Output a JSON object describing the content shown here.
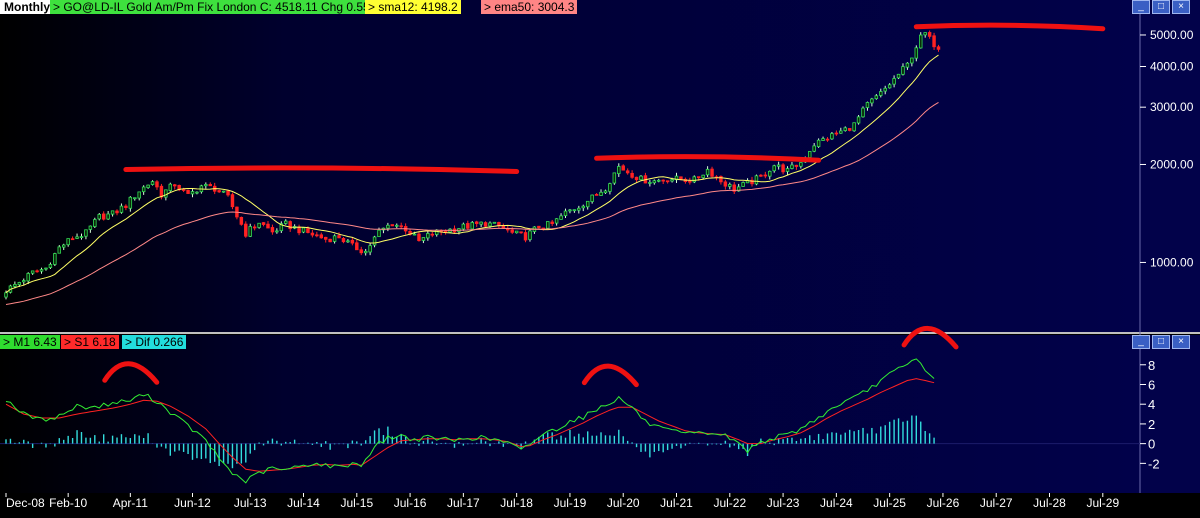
{
  "header": {
    "period": "Monthly",
    "symbol_label": "> GO@LD-IL  Gold Am/Pm Fix  London  C: 4518.11  Chg 0.55",
    "sma_label": "> sma12: 4198.2",
    "ema_label": "> ema50: 3004.3"
  },
  "indicator_header": {
    "m1_label": "> M1  6.43",
    "s1_label": "> S1  6.18",
    "dif_label": "> Dif  0.266"
  },
  "window_buttons": [
    "minimize-icon",
    "restore-icon",
    "close-icon"
  ],
  "colors": {
    "background": "#01014a",
    "up_candle": "#33dd55",
    "down_candle": "#ff2222",
    "sma": "#ffff66",
    "ema": "#ff8888",
    "m1": "#33ee33",
    "s1": "#ff2222",
    "dif": "#33dddd",
    "annotation": "#ee1111"
  },
  "chart_data": [
    {
      "type": "line",
      "title": "Gold Am/Pm Fix London (Monthly)",
      "scale": "log",
      "ylim": [
        620,
        5800
      ],
      "y_ticks": [
        "1000.00",
        "2000.00",
        "3000.00",
        "4000.00",
        "5000.00"
      ],
      "y_tick_values": [
        1000,
        2000,
        3000,
        4000,
        5000
      ],
      "x_ticks": [
        "Dec-08",
        "Feb-10",
        "Apr-11",
        "Jun-12",
        "Jul-13",
        "Jul-14",
        "Jul-15",
        "Jul-16",
        "Jul-17",
        "Jul-18",
        "Jul-19",
        "Jul-20",
        "Jul-21",
        "Jul-22",
        "Jul-23",
        "Jul-24",
        "Jul-25",
        "Jul-26",
        "Jul-27",
        "Jul-28",
        "Jul-29"
      ],
      "x_tick_months": [
        0,
        14,
        28,
        42,
        55,
        67,
        79,
        91,
        103,
        115,
        127,
        139,
        151,
        163,
        175,
        187,
        199,
        211,
        223,
        235,
        247
      ],
      "price_keypoints": [
        [
          0,
          820
        ],
        [
          3,
          870
        ],
        [
          6,
          930
        ],
        [
          9,
          960
        ],
        [
          12,
          1110
        ],
        [
          15,
          1190
        ],
        [
          18,
          1230
        ],
        [
          21,
          1380
        ],
        [
          24,
          1410
        ],
        [
          27,
          1500
        ],
        [
          30,
          1660
        ],
        [
          33,
          1780
        ],
        [
          35,
          1620
        ],
        [
          38,
          1740
        ],
        [
          41,
          1600
        ],
        [
          44,
          1720
        ],
        [
          47,
          1690
        ],
        [
          50,
          1580
        ],
        [
          52,
          1390
        ],
        [
          54,
          1230
        ],
        [
          57,
          1330
        ],
        [
          60,
          1240
        ],
        [
          63,
          1310
        ],
        [
          66,
          1260
        ],
        [
          69,
          1220
        ],
        [
          72,
          1180
        ],
        [
          75,
          1200
        ],
        [
          78,
          1120
        ],
        [
          81,
          1080
        ],
        [
          84,
          1240
        ],
        [
          87,
          1320
        ],
        [
          90,
          1270
        ],
        [
          93,
          1160
        ],
        [
          96,
          1230
        ],
        [
          99,
          1250
        ],
        [
          102,
          1280
        ],
        [
          105,
          1300
        ],
        [
          108,
          1320
        ],
        [
          111,
          1290
        ],
        [
          114,
          1230
        ],
        [
          117,
          1200
        ],
        [
          120,
          1290
        ],
        [
          123,
          1310
        ],
        [
          126,
          1420
        ],
        [
          129,
          1490
        ],
        [
          132,
          1580
        ],
        [
          135,
          1700
        ],
        [
          138,
          1970
        ],
        [
          140,
          1900
        ],
        [
          143,
          1800
        ],
        [
          146,
          1780
        ],
        [
          149,
          1810
        ],
        [
          152,
          1800
        ],
        [
          155,
          1790
        ],
        [
          158,
          1930
        ],
        [
          161,
          1780
        ],
        [
          164,
          1680
        ],
        [
          167,
          1750
        ],
        [
          170,
          1830
        ],
        [
          173,
          1990
        ],
        [
          176,
          1910
        ],
        [
          179,
          2030
        ],
        [
          182,
          2310
        ],
        [
          185,
          2420
        ],
        [
          188,
          2520
        ],
        [
          191,
          2650
        ],
        [
          194,
          3050
        ],
        [
          197,
          3300
        ],
        [
          200,
          3650
        ],
        [
          203,
          4050
        ],
        [
          206,
          4900
        ],
        [
          207,
          5050
        ],
        [
          208,
          4850
        ],
        [
          209,
          4700
        ],
        [
          210,
          4518
        ]
      ],
      "series": [
        {
          "name": "sma12",
          "value_last": 4198.2
        },
        {
          "name": "ema50",
          "value_last": 3004.3
        }
      ],
      "annotations": [
        {
          "kind": "resistance-line",
          "from_month": 27,
          "to_month": 115,
          "price": 1930
        },
        {
          "kind": "resistance-line",
          "from_month": 133,
          "to_month": 183,
          "price": 2090
        },
        {
          "kind": "resistance-line",
          "from_month": 205,
          "to_month": 247,
          "price": 5300
        }
      ]
    },
    {
      "type": "line",
      "title": "M1 / S1 / Dif",
      "ylim": [
        -4.5,
        9.6
      ],
      "y_ticks": [
        "8",
        "6",
        "4",
        "2",
        "0",
        "-2"
      ],
      "y_tick_values": [
        8,
        6,
        4,
        2,
        0,
        -2
      ],
      "m1_keypoints": [
        [
          0,
          4.5
        ],
        [
          4,
          3.0
        ],
        [
          8,
          2.4
        ],
        [
          12,
          2.8
        ],
        [
          16,
          3.8
        ],
        [
          20,
          3.7
        ],
        [
          24,
          4.1
        ],
        [
          28,
          4.4
        ],
        [
          31,
          5.0
        ],
        [
          34,
          4.3
        ],
        [
          37,
          3.2
        ],
        [
          41,
          1.8
        ],
        [
          45,
          0.3
        ],
        [
          48,
          -1.5
        ],
        [
          51,
          -3.0
        ],
        [
          54,
          -3.8
        ],
        [
          57,
          -3.0
        ],
        [
          60,
          -2.5
        ],
        [
          63,
          -2.7
        ],
        [
          66,
          -2.3
        ],
        [
          69,
          -2.0
        ],
        [
          72,
          -2.2
        ],
        [
          75,
          -2.4
        ],
        [
          78,
          -2.0
        ],
        [
          80,
          -2.2
        ],
        [
          83,
          -0.3
        ],
        [
          86,
          0.6
        ],
        [
          89,
          0.8
        ],
        [
          92,
          0.4
        ],
        [
          95,
          0.6
        ],
        [
          98,
          0.5
        ],
        [
          101,
          0.3
        ],
        [
          104,
          0.6
        ],
        [
          107,
          0.6
        ],
        [
          110,
          0.4
        ],
        [
          113,
          0.1
        ],
        [
          116,
          -0.7
        ],
        [
          118,
          0.0
        ],
        [
          121,
          1.0
        ],
        [
          124,
          1.5
        ],
        [
          127,
          2.3
        ],
        [
          130,
          2.7
        ],
        [
          133,
          3.5
        ],
        [
          136,
          4.2
        ],
        [
          138,
          4.6
        ],
        [
          141,
          3.7
        ],
        [
          144,
          2.2
        ],
        [
          147,
          1.6
        ],
        [
          150,
          1.2
        ],
        [
          153,
          1.0
        ],
        [
          156,
          1.0
        ],
        [
          159,
          1.1
        ],
        [
          162,
          0.8
        ],
        [
          165,
          0.0
        ],
        [
          167,
          -0.7
        ],
        [
          170,
          0.2
        ],
        [
          173,
          0.6
        ],
        [
          176,
          0.9
        ],
        [
          179,
          1.5
        ],
        [
          182,
          2.4
        ],
        [
          185,
          3.2
        ],
        [
          188,
          4.1
        ],
        [
          191,
          4.6
        ],
        [
          194,
          5.4
        ],
        [
          197,
          6.4
        ],
        [
          200,
          7.3
        ],
        [
          203,
          8.0
        ],
        [
          205,
          8.6
        ],
        [
          207,
          7.6
        ],
        [
          209,
          6.43
        ]
      ],
      "s1_keypoints": [
        [
          0,
          4.0
        ],
        [
          4,
          3.0
        ],
        [
          8,
          2.6
        ],
        [
          12,
          2.6
        ],
        [
          16,
          3.0
        ],
        [
          20,
          3.3
        ],
        [
          24,
          3.6
        ],
        [
          28,
          4.0
        ],
        [
          31,
          4.4
        ],
        [
          34,
          4.3
        ],
        [
          37,
          3.8
        ],
        [
          41,
          2.8
        ],
        [
          45,
          1.5
        ],
        [
          48,
          0.0
        ],
        [
          51,
          -1.4
        ],
        [
          54,
          -2.6
        ],
        [
          57,
          -2.8
        ],
        [
          60,
          -2.7
        ],
        [
          63,
          -2.6
        ],
        [
          66,
          -2.4
        ],
        [
          69,
          -2.2
        ],
        [
          72,
          -2.1
        ],
        [
          75,
          -2.2
        ],
        [
          78,
          -2.1
        ],
        [
          80,
          -2.2
        ],
        [
          83,
          -1.3
        ],
        [
          86,
          -0.4
        ],
        [
          89,
          0.3
        ],
        [
          92,
          0.4
        ],
        [
          95,
          0.5
        ],
        [
          98,
          0.5
        ],
        [
          101,
          0.4
        ],
        [
          104,
          0.5
        ],
        [
          107,
          0.5
        ],
        [
          110,
          0.4
        ],
        [
          113,
          0.2
        ],
        [
          116,
          -0.3
        ],
        [
          118,
          -0.2
        ],
        [
          121,
          0.4
        ],
        [
          124,
          0.9
        ],
        [
          127,
          1.5
        ],
        [
          130,
          2.1
        ],
        [
          133,
          2.8
        ],
        [
          136,
          3.4
        ],
        [
          138,
          3.7
        ],
        [
          141,
          3.7
        ],
        [
          144,
          3.0
        ],
        [
          147,
          2.3
        ],
        [
          150,
          1.8
        ],
        [
          153,
          1.3
        ],
        [
          156,
          1.1
        ],
        [
          159,
          1.0
        ],
        [
          162,
          0.9
        ],
        [
          165,
          0.4
        ],
        [
          167,
          0.0
        ],
        [
          170,
          0.0
        ],
        [
          173,
          0.4
        ],
        [
          176,
          0.7
        ],
        [
          179,
          1.1
        ],
        [
          182,
          1.8
        ],
        [
          185,
          2.6
        ],
        [
          188,
          3.3
        ],
        [
          191,
          3.9
        ],
        [
          194,
          4.5
        ],
        [
          197,
          5.2
        ],
        [
          200,
          5.8
        ],
        [
          203,
          6.4
        ],
        [
          205,
          6.6
        ],
        [
          207,
          6.4
        ],
        [
          209,
          6.18
        ]
      ],
      "annotations": [
        {
          "kind": "peak-arc",
          "month": 29
        },
        {
          "kind": "peak-arc",
          "month": 137
        },
        {
          "kind": "peak-arc",
          "month": 209
        }
      ]
    }
  ]
}
